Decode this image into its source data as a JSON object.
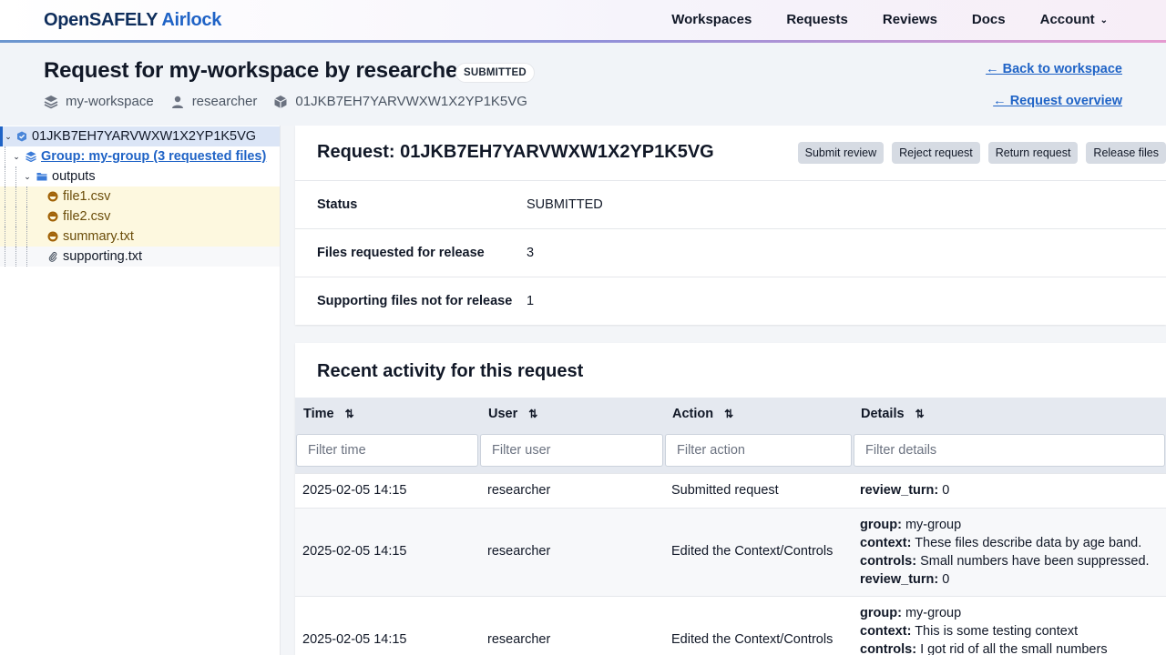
{
  "header": {
    "brand_main": "OpenSAFELY",
    "brand_accent": "Airlock",
    "nav": [
      "Workspaces",
      "Requests",
      "Reviews",
      "Docs",
      "Account"
    ]
  },
  "title": {
    "text": "Request for my-workspace by researcher",
    "status_badge": "SUBMITTED",
    "workspace": "my-workspace",
    "user": "researcher",
    "request_id": "01JKB7EH7YARVWXW1X2YP1K5VG",
    "back_to_workspace": "← Back to workspace",
    "request_overview": "← Request overview"
  },
  "tree": {
    "root": "01JKB7EH7YARVWXW1X2YP1K5VG",
    "group": "Group: my-group (3 requested files)",
    "folder": "outputs",
    "files": [
      "file1.csv",
      "file2.csv",
      "summary.txt"
    ],
    "supporting": "supporting.txt"
  },
  "request": {
    "title": "Request: 01JKB7EH7YARVWXW1X2YP1K5VG",
    "buttons": [
      "Submit review",
      "Reject request",
      "Return request",
      "Release files"
    ],
    "rows": [
      {
        "label": "Status",
        "value": "SUBMITTED"
      },
      {
        "label": "Files requested for release",
        "value": "3"
      },
      {
        "label": "Supporting files not for release",
        "value": "1"
      }
    ]
  },
  "activity": {
    "title": "Recent activity for this request",
    "columns": [
      "Time",
      "User",
      "Action",
      "Details"
    ],
    "filters": [
      "Filter time",
      "Filter user",
      "Filter action",
      "Filter details"
    ],
    "rows": [
      {
        "time": "2025-02-05 14:15",
        "user": "researcher",
        "action": "Submitted request",
        "details": [
          {
            "k": "review_turn:",
            "v": "0"
          }
        ]
      },
      {
        "time": "2025-02-05 14:15",
        "user": "researcher",
        "action": "Edited the Context/Controls",
        "details": [
          {
            "k": "group:",
            "v": "my-group"
          },
          {
            "k": "context:",
            "v": "These files describe data by age band."
          },
          {
            "k": "controls:",
            "v": "Small numbers have been suppressed."
          },
          {
            "k": "review_turn:",
            "v": "0"
          }
        ]
      },
      {
        "time": "2025-02-05 14:15",
        "user": "researcher",
        "action": "Edited the Context/Controls",
        "details": [
          {
            "k": "group:",
            "v": "my-group"
          },
          {
            "k": "context:",
            "v": "This is some testing context"
          },
          {
            "k": "controls:",
            "v": "I got rid of all the small numbers"
          }
        ]
      }
    ]
  }
}
